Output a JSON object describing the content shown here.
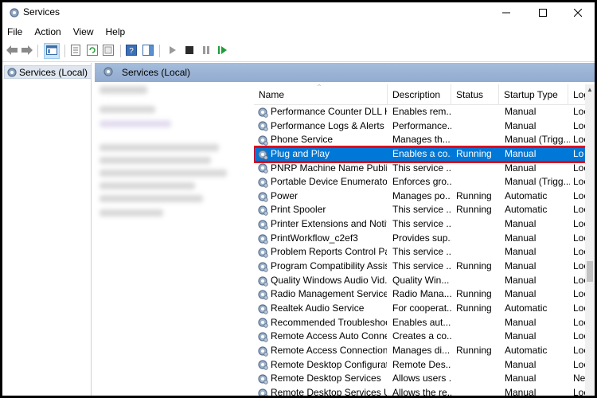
{
  "window": {
    "title": "Services"
  },
  "menu": [
    "File",
    "Action",
    "View",
    "Help"
  ],
  "tree": {
    "root_label": "Services (Local)"
  },
  "content": {
    "header_title": "Services (Local)"
  },
  "columns": {
    "name": "Name",
    "description": "Description",
    "status": "Status",
    "startup_type": "Startup Type",
    "log_on_as": "Log"
  },
  "services": [
    {
      "name": "Performance Counter DLL H...",
      "description": "Enables rem...",
      "status": "",
      "startup": "Manual",
      "logon": "Loc"
    },
    {
      "name": "Performance Logs & Alerts",
      "description": "Performance...",
      "status": "",
      "startup": "Manual",
      "logon": "Loc"
    },
    {
      "name": "Phone Service",
      "description": "Manages th...",
      "status": "",
      "startup": "Manual (Trigg...",
      "logon": "Loc"
    },
    {
      "name": "Plug and Play",
      "description": "Enables a co...",
      "status": "Running",
      "startup": "Manual",
      "logon": "Lo",
      "selected": true
    },
    {
      "name": "PNRP Machine Name Public...",
      "description": "This service ...",
      "status": "",
      "startup": "Manual",
      "logon": "Loc"
    },
    {
      "name": "Portable Device Enumerator ...",
      "description": "Enforces gro...",
      "status": "",
      "startup": "Manual (Trigg...",
      "logon": "Loc"
    },
    {
      "name": "Power",
      "description": "Manages po...",
      "status": "Running",
      "startup": "Automatic",
      "logon": "Loc"
    },
    {
      "name": "Print Spooler",
      "description": "This service ...",
      "status": "Running",
      "startup": "Automatic",
      "logon": "Loc"
    },
    {
      "name": "Printer Extensions and Notifi...",
      "description": "This service ...",
      "status": "",
      "startup": "Manual",
      "logon": "Loc"
    },
    {
      "name": "PrintWorkflow_c2ef3",
      "description": "Provides sup...",
      "status": "",
      "startup": "Manual",
      "logon": "Loc"
    },
    {
      "name": "Problem Reports Control Pa...",
      "description": "This service ...",
      "status": "",
      "startup": "Manual",
      "logon": "Loc"
    },
    {
      "name": "Program Compatibility Assis...",
      "description": "This service ...",
      "status": "Running",
      "startup": "Manual",
      "logon": "Loc"
    },
    {
      "name": "Quality Windows Audio Vid...",
      "description": "Quality Win...",
      "status": "",
      "startup": "Manual",
      "logon": "Loc"
    },
    {
      "name": "Radio Management Service",
      "description": "Radio Mana...",
      "status": "Running",
      "startup": "Manual",
      "logon": "Loc"
    },
    {
      "name": "Realtek Audio Service",
      "description": "For cooperat...",
      "status": "Running",
      "startup": "Automatic",
      "logon": "Loc"
    },
    {
      "name": "Recommended Troubleshoo...",
      "description": "Enables aut...",
      "status": "",
      "startup": "Manual",
      "logon": "Loc"
    },
    {
      "name": "Remote Access Auto Connec...",
      "description": "Creates a co...",
      "status": "",
      "startup": "Manual",
      "logon": "Loc"
    },
    {
      "name": "Remote Access Connection ...",
      "description": "Manages di...",
      "status": "Running",
      "startup": "Automatic",
      "logon": "Loc"
    },
    {
      "name": "Remote Desktop Configurati...",
      "description": "Remote Des...",
      "status": "",
      "startup": "Manual",
      "logon": "Loc"
    },
    {
      "name": "Remote Desktop Services",
      "description": "Allows users ...",
      "status": "",
      "startup": "Manual",
      "logon": "Ne"
    },
    {
      "name": "Remote Desktop Services Us...",
      "description": "Allows the re...",
      "status": "",
      "startup": "Manual",
      "logon": "Loc"
    }
  ],
  "colors": {
    "selection": "#0078d7",
    "highlight_box": "#e3001b",
    "pane_header": "#a6bddb"
  }
}
